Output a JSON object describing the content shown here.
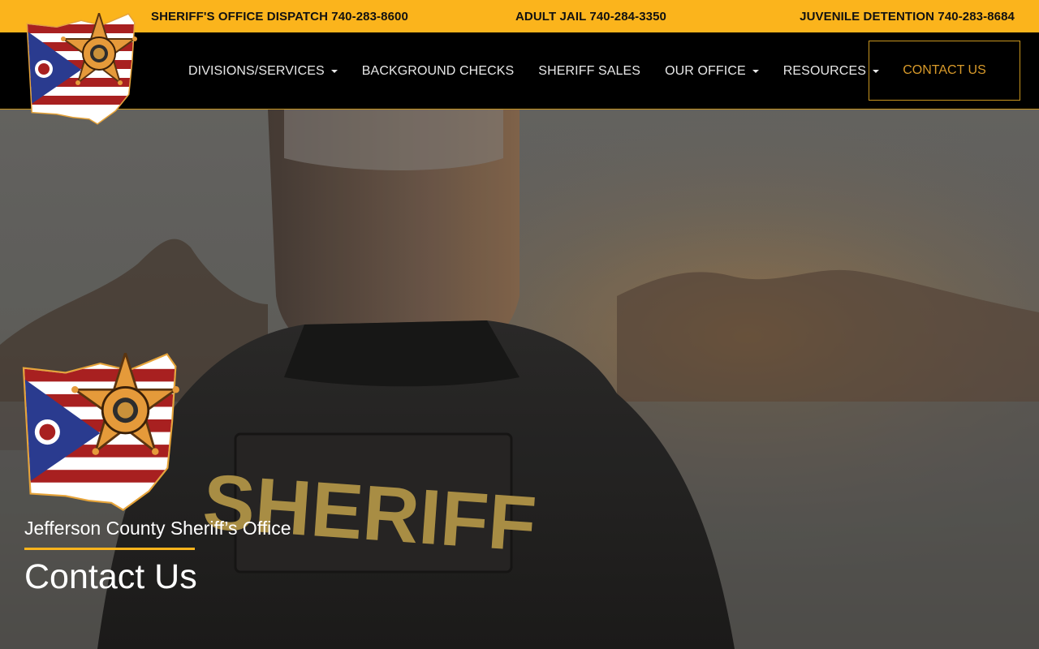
{
  "topbar": {
    "dispatch": "SHERIFF'S OFFICE DISPATCH 740-283-8600",
    "jail": "ADULT JAIL 740-284-3350",
    "juvenile": "JUVENILE DETENTION 740-283-8684"
  },
  "nav": {
    "logo_icon": "ohio-sheriffs-association-logo",
    "items": [
      {
        "label": "DIVISIONS/SERVICES",
        "dropdown": true
      },
      {
        "label": "BACKGROUND CHECKS",
        "dropdown": false
      },
      {
        "label": "SHERIFF SALES",
        "dropdown": false
      },
      {
        "label": "OUR OFFICE",
        "dropdown": true
      },
      {
        "label": "RESOURCES",
        "dropdown": true
      }
    ],
    "contact_label": "CONTACT US"
  },
  "hero": {
    "subtitle": "Jefferson County Sheriff’s Office",
    "title": "Contact Us",
    "badge_text": "SHERIFF",
    "logo_icon": "ohio-sheriffs-association-logo"
  },
  "colors": {
    "accent": "#fbb41c",
    "nav_bg": "#000000",
    "contact_text": "#d89a2a"
  }
}
